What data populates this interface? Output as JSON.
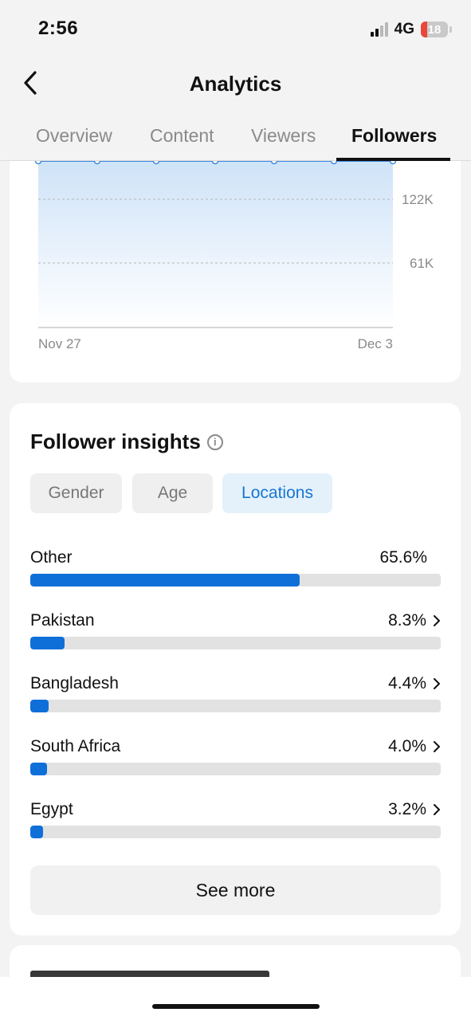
{
  "status_bar": {
    "time": "2:56",
    "network": "4G",
    "battery_level": "18",
    "battery_color": "#e8473c"
  },
  "header": {
    "title": "Analytics",
    "back_icon": "chevron-left-icon"
  },
  "tabs": [
    {
      "label": "Overview",
      "active": false
    },
    {
      "label": "Content",
      "active": false
    },
    {
      "label": "Viewers",
      "active": false
    },
    {
      "label": "Followers",
      "active": true
    }
  ],
  "follower_chart": {
    "y_ticks": [
      "122K",
      "61K"
    ],
    "x_start": "Nov 27",
    "x_end": "Dec 3",
    "line_color": "#3b86e0",
    "fill_color": "#cfe3f8"
  },
  "insights": {
    "title": "Follower insights",
    "info_icon": "info-icon",
    "filters": [
      {
        "label": "Gender",
        "active": false
      },
      {
        "label": "Age",
        "active": false
      },
      {
        "label": "Locations",
        "active": true
      }
    ],
    "locations": [
      {
        "name": "Other",
        "percent": "65.6%",
        "value": 65.6,
        "has_chevron": false
      },
      {
        "name": "Pakistan",
        "percent": "8.3%",
        "value": 8.3,
        "has_chevron": true
      },
      {
        "name": "Bangladesh",
        "percent": "4.4%",
        "value": 4.4,
        "has_chevron": true
      },
      {
        "name": "South Africa",
        "percent": "4.0%",
        "value": 4.0,
        "has_chevron": true
      },
      {
        "name": "Egypt",
        "percent": "3.2%",
        "value": 3.2,
        "has_chevron": true
      }
    ],
    "see_more_label": "See more",
    "accent_color": "#0f6fd9"
  }
}
